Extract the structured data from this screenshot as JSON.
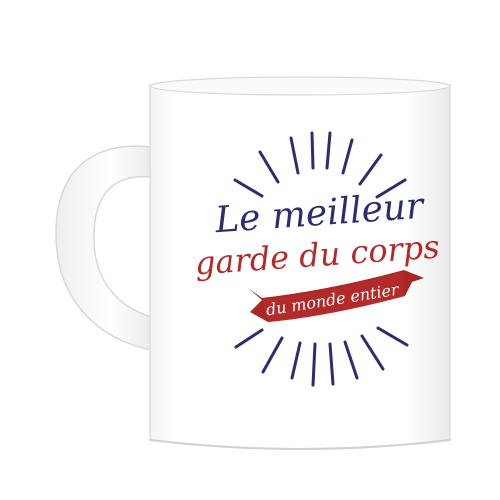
{
  "product": {
    "line1": "Le meilleur",
    "line2": "garde du corps",
    "banner": "du monde entier"
  },
  "colors": {
    "background": "#ffffff",
    "mug_body": "#ffffff",
    "mug_shadow": "#e6e6e6",
    "navy": "#2b2e6e",
    "red": "#b32a2a",
    "banner_text": "#ffffff"
  }
}
